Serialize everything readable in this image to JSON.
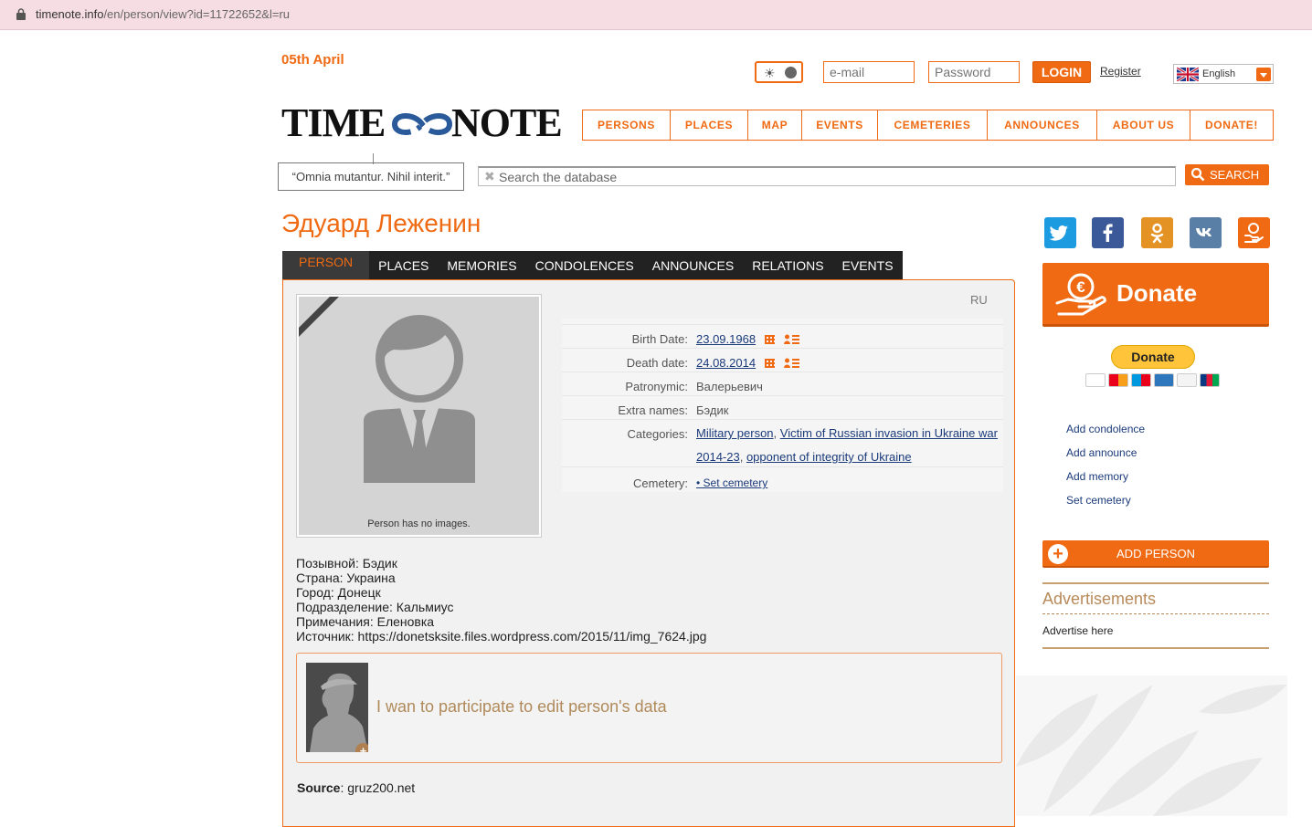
{
  "browser": {
    "url_host": "timenote.info",
    "url_path": "/en/person/view?id=11722652&l=ru"
  },
  "header": {
    "date": "05th April",
    "email_placeholder": "e-mail",
    "password_placeholder": "Password",
    "login_label": "LOGIN",
    "register_label": "Register",
    "language": "English"
  },
  "logo": {
    "left": "TIME",
    "right": "NOTE"
  },
  "nav": [
    "PERSONS",
    "PLACES",
    "MAP",
    "EVENTS",
    "CEMETERIES",
    "ANNOUNCES",
    "ABOUT US",
    "DONATE!"
  ],
  "motto": "“Omnia mutantur. Nihil interit.”",
  "search": {
    "placeholder": "Search the database",
    "button": "SEARCH"
  },
  "person": {
    "name": "Эдуард Леженин",
    "tabs": [
      "PERSON",
      "PLACES",
      "MEMORIES",
      "CONDOLENCES",
      "ANNOUNCES",
      "RELATIONS",
      "EVENTS"
    ],
    "lang_code": "RU",
    "no_images": "Person has no images.",
    "birth_label": "Birth Date:",
    "birth_date": "23.09.1968",
    "death_label": "Death date:",
    "death_date": "24.08.2014",
    "patronymic_label": "Patronymic:",
    "patronymic": "Валерьевич",
    "extra_label": "Extra names:",
    "extra_names": "Бэдик",
    "categories_label": "Categories:",
    "categories": [
      "Military person",
      "Victim of Russian invasion in Ukraine war 2014-23",
      "opponent of integrity of Ukraine"
    ],
    "cemetery_label": "Cemetery:",
    "cemetery": "• Set cemetery",
    "bio": [
      "Позывной: Бэдик",
      "Страна: Украина",
      "Город: Донецк",
      "Подразделение: Кальмиус",
      "Примечания: Еленовка",
      "Источник: https://donetsksite.files.wordpress.com/2015/11/img_7624.jpg"
    ],
    "edit_prompt": "I wan to participate to edit person's data",
    "source_label": "Source",
    "source_value": ": gruz200.net"
  },
  "sidebar": {
    "donate_label": "Donate",
    "paypal_label": "Donate",
    "links": [
      "Add condolence",
      "Add announce",
      "Add memory",
      "Set cemetery"
    ],
    "add_person": "ADD PERSON",
    "ads_title": "Advertisements",
    "ads_text": "Advertise here"
  },
  "colors": {
    "accent": "#ef6a12",
    "link": "#1a3a7a",
    "tan": "#b88a5a"
  }
}
